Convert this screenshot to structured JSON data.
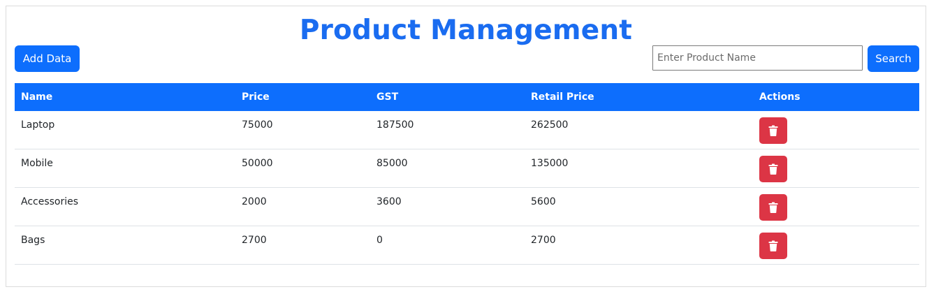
{
  "header": {
    "title": "Product Management"
  },
  "toolbar": {
    "add_label": "Add Data",
    "search_placeholder": "Enter Product Name",
    "search_value": "",
    "search_label": "Search"
  },
  "table": {
    "columns": [
      "Name",
      "Price",
      "GST",
      "Retail Price",
      "Actions"
    ],
    "rows": [
      {
        "name": "Laptop",
        "price": "75000",
        "gst": "187500",
        "retail": "262500"
      },
      {
        "name": "Mobile",
        "price": "50000",
        "gst": "85000",
        "retail": "135000"
      },
      {
        "name": "Accessories",
        "price": "2000",
        "gst": "3600",
        "retail": "5600"
      },
      {
        "name": "Bags",
        "price": "2700",
        "gst": "0",
        "retail": "2700"
      }
    ],
    "row_action_icon": "trash-icon"
  },
  "colors": {
    "primary": "#0d6efd",
    "title": "#1a6cf0",
    "danger": "#dc3545"
  }
}
